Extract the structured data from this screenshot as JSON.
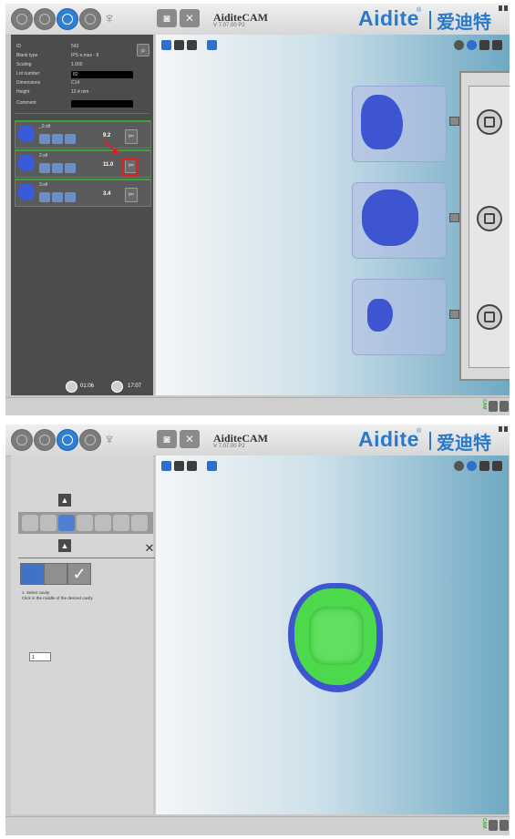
{
  "app": {
    "name": "AiditeCAM",
    "version": "V 7.07.00 P2",
    "brand": "Aidite",
    "brand_reg": "®",
    "brand_cn": "爱迪特"
  },
  "screen1": {
    "info": [
      {
        "label": "ID",
        "value": "543"
      },
      {
        "label": "Blank type",
        "value": "IPS e.max - 8"
      },
      {
        "label": "Scaling",
        "value": "1.000"
      },
      {
        "label": "Lot number",
        "value": "82"
      },
      {
        "label": "Dimensions",
        "value": "C14"
      },
      {
        "label": "Height",
        "value": "12.4  mm"
      },
      {
        "label": "Comment",
        "value": ""
      }
    ],
    "files": [
      {
        "name": "_0.stl",
        "value": "9.2"
      },
      {
        "name": "2.stl",
        "value": "11.0"
      },
      {
        "name": "3.stl",
        "value": "3.4"
      }
    ],
    "timers": {
      "elapsed": "01:06",
      "remaining": "17:07"
    }
  },
  "screen2": {
    "instruction_title": "1. Select cavity",
    "instruction_text": "Click in the middle of the desired cavity",
    "count_value": "1"
  },
  "bottom": {
    "cam_label": "CAM"
  },
  "colors": {
    "accent": "#2b79c9",
    "tooth_blue": "#3e55d1",
    "tooth_green": "#4cd94c",
    "highlight_red": "#e02020"
  }
}
